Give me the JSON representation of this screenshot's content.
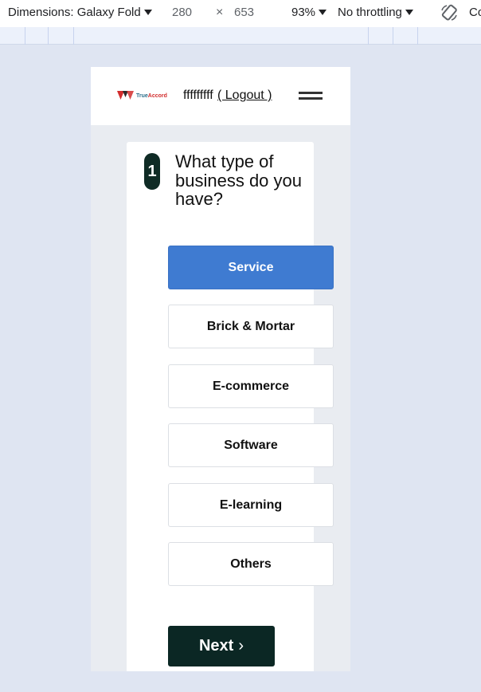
{
  "devtools": {
    "dimensions_label": "Dimensions: Galaxy Fold",
    "width": "280",
    "times": "×",
    "height": "653",
    "zoom": "93%",
    "throttling": "No throttling",
    "more": "Co"
  },
  "header": {
    "logo_text_true": "True",
    "logo_text_accord": "Accord",
    "username": "fffffffff",
    "logout_label": "( Logout )"
  },
  "question": {
    "step": "1",
    "text": "What type of business do you have?"
  },
  "options": [
    {
      "label": "Service",
      "selected": true
    },
    {
      "label": "Brick & Mortar",
      "selected": false
    },
    {
      "label": "E-commerce",
      "selected": false
    },
    {
      "label": "Software",
      "selected": false
    },
    {
      "label": "E-learning",
      "selected": false
    },
    {
      "label": "Others",
      "selected": false
    }
  ],
  "next_button": {
    "label": "Next",
    "chevron": "›"
  },
  "colors": {
    "selected_option": "#3f7bd1",
    "primary_dark": "#0b2724",
    "page_background": "#dfe5f2"
  }
}
